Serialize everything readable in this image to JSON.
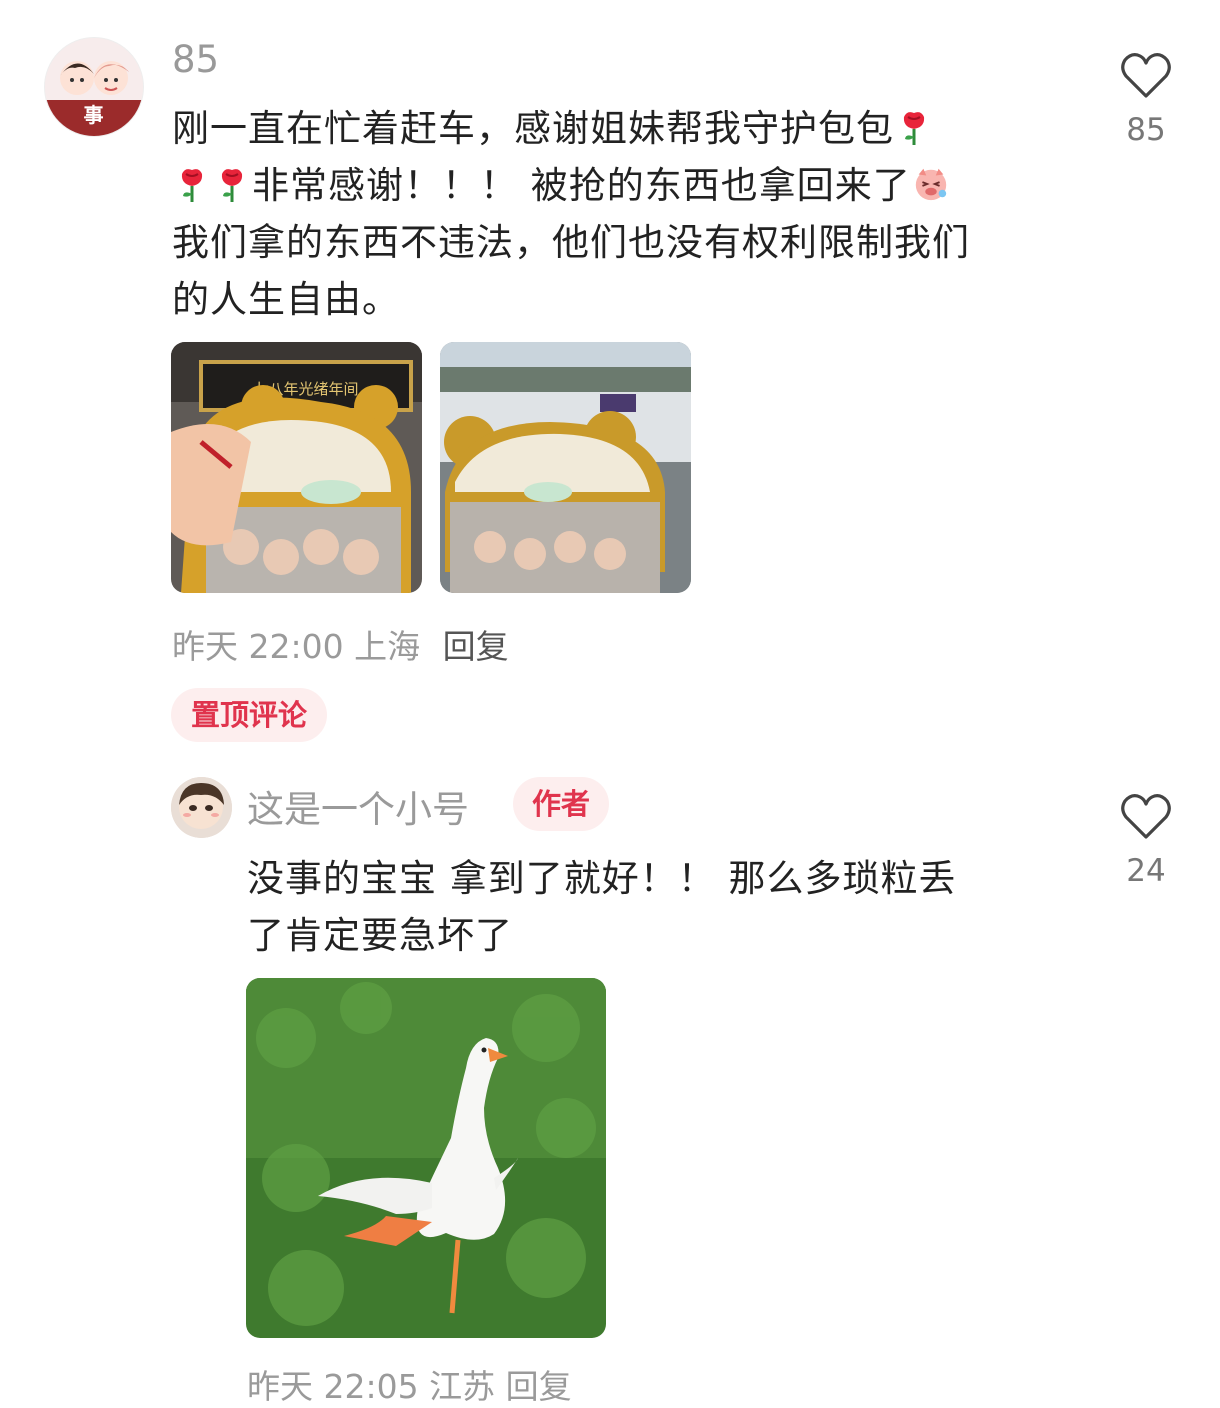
{
  "comment": {
    "avatar_label": "事",
    "username": "85",
    "lines": [
      "刚一直在忙着赶车，感谢姐妹帮我守护包包",
      "非常感谢！！！ 被抢的东西也拿回来了",
      "我们拿的东西不违法，他们也没有权利限制我们",
      "的人生自由。"
    ],
    "photo1_sign": "七八年光绪年间",
    "time": "昨天 22:00",
    "location": "上海",
    "reply_label": "回复",
    "pinned_label": "置顶评论",
    "like_count": "85",
    "like_icon": "heart-outline-icon"
  },
  "reply": {
    "username": "这是一个小号",
    "author_badge": "作者",
    "lines": [
      "没事的宝宝 拿到了就好！！ 那么多琐粒丢",
      "了肯定要急坏了"
    ],
    "meta_partial": "昨天 22:05 江苏 回复",
    "like_count": "24",
    "like_icon": "heart-outline-icon"
  },
  "colors": {
    "accent_red": "#e0344d",
    "badge_bg": "#fdeeee",
    "meta_gray": "#9a9a9a"
  }
}
